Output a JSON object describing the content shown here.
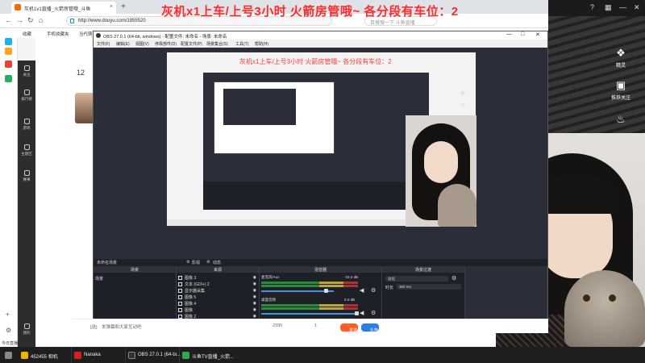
{
  "overlay": {
    "title": "灰机x1上车/上号3小时   火箭房管哦~   各分段有车位：2",
    "nested_title": "灰机x1上车/上号3小时   火箭房管哦~   各分段有车位：2"
  },
  "browser": {
    "tab_title": "灰机1v1直播_火箭房管哦_斗鱼",
    "url": "http://www.douyu.com/1855520",
    "search_placeholder": "百搜搜一下 斗鱼直播",
    "bookmarks": [
      "收藏",
      "手机收藏夹",
      "当代萌宠"
    ]
  },
  "douyu": {
    "left_count": "12",
    "sidenav": [
      "关注",
      "排行榜",
      "游戏",
      "主题区",
      "赛事",
      "我的"
    ],
    "bottom_bar": {
      "prefix": "[送]",
      "placeholder": "发弹幕和大家互动吧",
      "count1": "2395",
      "count2": "1",
      "send": "发送",
      "gift": "礼物"
    },
    "bottom_left": "今日直播"
  },
  "obs": {
    "title": "OBS 27.0.1 (64-bit, windows) - 配置文件: 未命名 - 场景: 未命名",
    "menu": [
      "文件(F)",
      "编辑(E)",
      "视图(V)",
      "停靠部件(D)",
      "配置文件(P)",
      "场景集合(S)",
      "工具(T)",
      "帮助(H)"
    ],
    "scene_bar": [
      "未命名场景",
      "影视",
      "动态"
    ],
    "docks": {
      "scenes": {
        "title": "场景",
        "items": [
          "场景"
        ]
      },
      "sources": {
        "title": "来源",
        "items": [
          "图像 3",
          "文本 (GDI+) 2",
          "显示器采集",
          "图像 5",
          "图像 4",
          "图像",
          "图像 2"
        ]
      },
      "mixer": {
        "title": "混音器",
        "channels": [
          {
            "name": "麦克风/Aux",
            "db": "-33.2 dB"
          },
          {
            "name": "桌面音频",
            "db": "0.0 dB"
          }
        ]
      },
      "transitions": {
        "title": "场景过渡",
        "type": "淡化",
        "duration_label": "时长",
        "duration": "300 ms"
      }
    }
  },
  "right_panel": {
    "btn1": "精灵",
    "btn2": "推荐关注"
  },
  "taskbar": {
    "items": [
      {
        "label": "452455 相机",
        "color": "#f0b400"
      },
      {
        "label": "Nanaka",
        "color": "#d81e1e"
      },
      {
        "label": "OBS 27.0.1 (64-bi...",
        "color": "#303030"
      },
      {
        "label": "斗鱼TV直播_火箭...",
        "color": "#2fa84f"
      }
    ]
  },
  "colors": {
    "accent_red": "#ff2a2a",
    "obs_bg": "#2b2e38",
    "dock_bg": "#1e2028"
  }
}
